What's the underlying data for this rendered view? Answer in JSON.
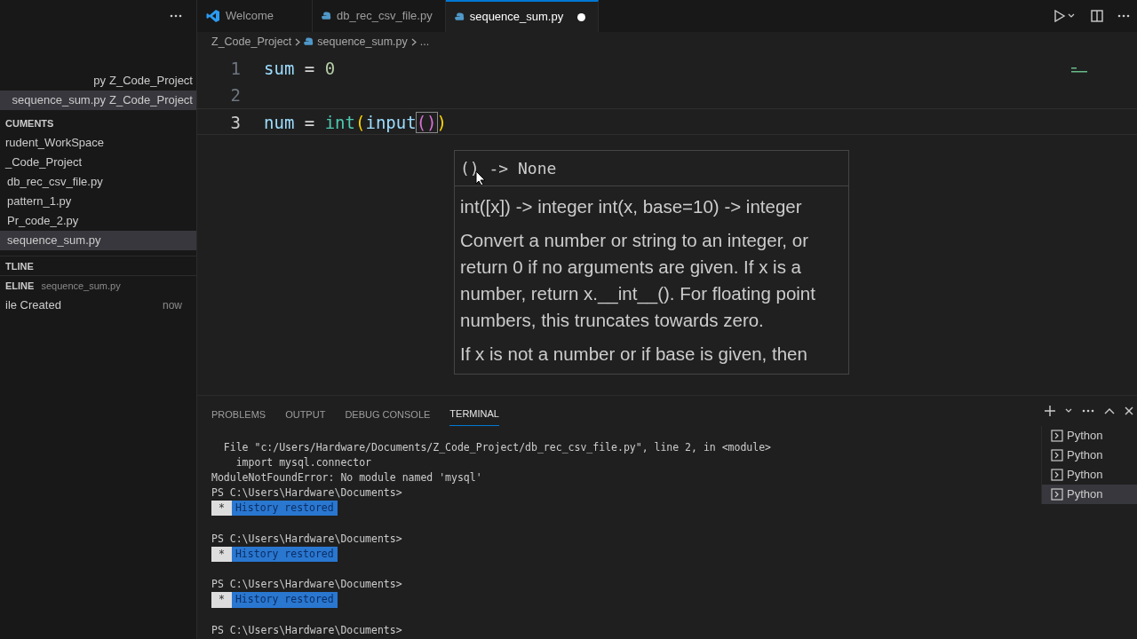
{
  "sidebar": {
    "open_editors": [
      {
        "name": "py",
        "folder": "Z_Code_Project",
        "selected": false
      },
      {
        "name": "sequence_sum.py",
        "folder": "Z_Code_Project",
        "selected": true
      }
    ],
    "folder_header": "CUMENTS",
    "files": [
      {
        "name": "rudent_WorkSpace",
        "selected": false
      },
      {
        "name": "_Code_Project",
        "selected": false,
        "children": [
          {
            "name": "db_rec_csv_file.py",
            "selected": false
          },
          {
            "name": "pattern_1.py",
            "selected": false
          },
          {
            "name": "Pr_code_2.py",
            "selected": false
          },
          {
            "name": "sequence_sum.py",
            "selected": true
          }
        ]
      }
    ],
    "outline_header": "TLINE",
    "timeline": {
      "header": "ELINE",
      "file": "sequence_sum.py",
      "entries": [
        {
          "label": "ile Created",
          "time": "now"
        }
      ]
    }
  },
  "tabs": [
    {
      "label": "Welcome",
      "kind": "welcome",
      "selected": false,
      "dirty": false
    },
    {
      "label": "db_rec_csv_file.py",
      "kind": "python",
      "selected": false,
      "dirty": false
    },
    {
      "label": "sequence_sum.py",
      "kind": "python",
      "selected": true,
      "dirty": true
    }
  ],
  "breadcrumb": [
    "Z_Code_Project",
    "sequence_sum.py",
    "..."
  ],
  "code": [
    {
      "number": "1",
      "tokens": [
        {
          "text": "sum",
          "kind": "var"
        },
        {
          "text": " = ",
          "kind": "op"
        },
        {
          "text": "0",
          "kind": "num"
        }
      ]
    },
    {
      "number": "2"
    },
    {
      "number": "3",
      "tokens": [
        {
          "text": "num",
          "kind": "var"
        },
        {
          "text": " = ",
          "kind": "op"
        },
        {
          "text": "int",
          "kind": "func"
        },
        {
          "text": "(",
          "kind": "paren"
        },
        {
          "text": "input",
          "kind": "var"
        },
        {
          "text": "()",
          "kind": "paren2"
        },
        {
          "text": ")",
          "kind": "paren"
        }
      ]
    }
  ],
  "hover": {
    "signature": "() -> None",
    "doc_signature": "int([x]) -> integer int(x, base=10) -> integer",
    "paragraphs": [
      "Convert a number or string to an integer, or return 0 if no arguments are given. If x is a number, return x.__int__(). For floating point numbers, this truncates towards zero.",
      "If x is not a number or if base is given, then"
    ]
  },
  "panel": {
    "tabs": [
      {
        "label": "PROBLEMS",
        "selected": false
      },
      {
        "label": "OUTPUT",
        "selected": false
      },
      {
        "label": "DEBUG CONSOLE",
        "selected": false
      },
      {
        "label": "TERMINAL",
        "selected": true
      }
    ],
    "terminal": [
      {
        "kind": "text",
        "text": "  File \"c:/Users/Hardware/Documents/Z_Code_Project/db_rec_csv_file.py\", line 2, in <module>"
      },
      {
        "kind": "text",
        "text": "    import mysql.connector"
      },
      {
        "kind": "text",
        "text": "ModuleNotFoundError: No module named 'mysql'"
      },
      {
        "kind": "text",
        "text": "PS C:\\Users\\Hardware\\Documents>"
      },
      {
        "kind": "badge",
        "mark": "*",
        "text": "History restored"
      },
      {
        "kind": "blank"
      },
      {
        "kind": "text",
        "text": "PS C:\\Users\\Hardware\\Documents>"
      },
      {
        "kind": "badge",
        "mark": "*",
        "text": "History restored"
      },
      {
        "kind": "blank"
      },
      {
        "kind": "text",
        "text": "PS C:\\Users\\Hardware\\Documents>"
      },
      {
        "kind": "badge",
        "mark": "*",
        "text": "History restored"
      },
      {
        "kind": "blank"
      },
      {
        "kind": "text",
        "text": "PS C:\\Users\\Hardware\\Documents>"
      }
    ],
    "terminals": [
      {
        "label": "Python",
        "selected": false
      },
      {
        "label": "Python",
        "selected": false
      },
      {
        "label": "Python",
        "selected": false
      },
      {
        "label": "Python",
        "selected": true
      }
    ]
  }
}
